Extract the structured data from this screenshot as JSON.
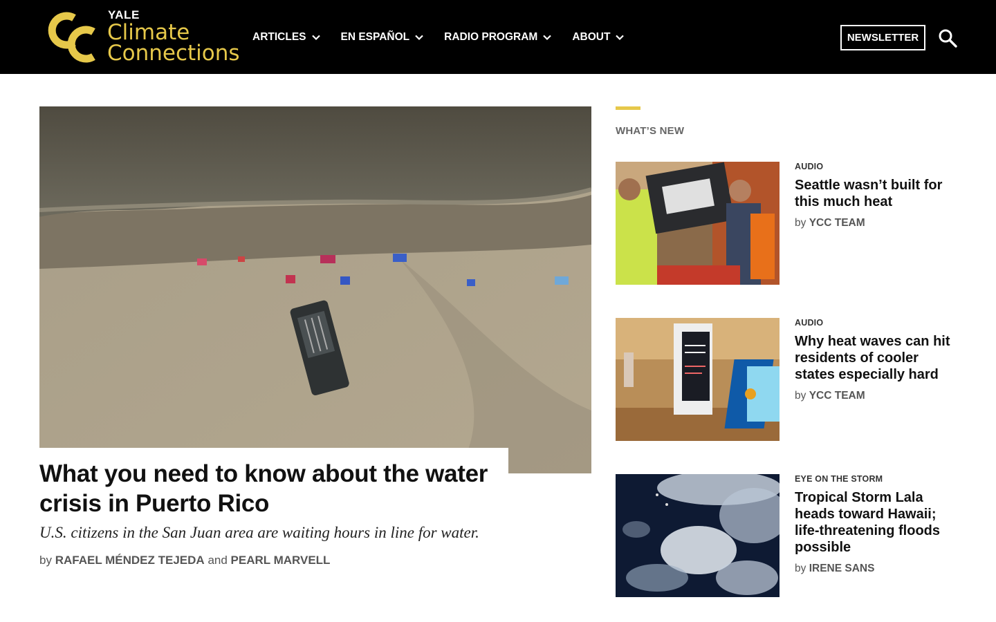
{
  "header": {
    "logo": {
      "line0": "YALE",
      "line1": "Climate",
      "line2": "Connections"
    },
    "nav": [
      {
        "label": "ARTICLES"
      },
      {
        "label": "EN ESPAÑOL"
      },
      {
        "label": "RADIO PROGRAM"
      },
      {
        "label": "ABOUT"
      }
    ],
    "newsletter_label": "NEWSLETTER",
    "search_icon": "search-icon"
  },
  "feature": {
    "title": "What you need to know about the water crisis in Puerto Rico",
    "dek": "U.S. citizens in the San Juan area are waiting hours in line for water.",
    "byline_prefix": "by",
    "author1": "RAFAEL MÉNDEZ TEJEDA",
    "byline_joiner": "and",
    "author2": "PEARL MARVELL"
  },
  "sidebar": {
    "heading": "WHAT’S NEW",
    "cards": [
      {
        "kicker": "AUDIO",
        "title": "Seattle wasn’t built for this much heat",
        "byline_prefix": "by",
        "author": "YCC TEAM"
      },
      {
        "kicker": "AUDIO",
        "title": "Why heat waves can hit residents of cooler states especially hard",
        "byline_prefix": "by",
        "author": "YCC TEAM"
      },
      {
        "kicker": "EYE ON THE STORM",
        "title": "Tropical Storm Lala heads toward Hawaii; life-threatening floods possible",
        "byline_prefix": "by",
        "author": "IRENE SANS"
      }
    ]
  },
  "colors": {
    "header_bg": "#000000",
    "brand_yellow": "#e6c84a",
    "text": "#111111",
    "muted": "#555555"
  }
}
